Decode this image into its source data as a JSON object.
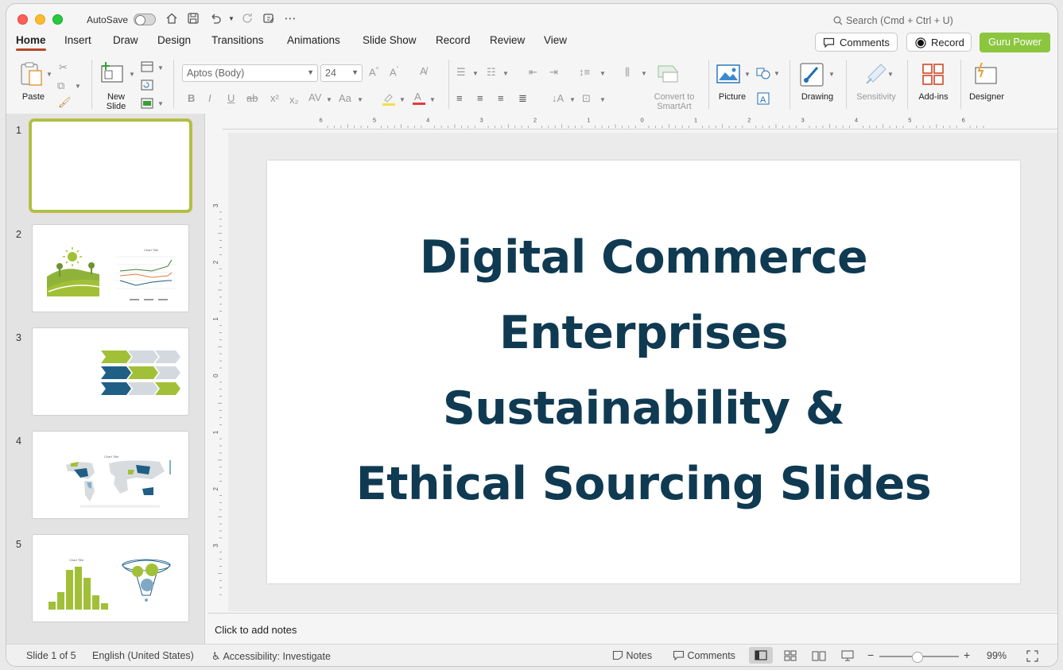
{
  "titlebar": {
    "autosave_label": "AutoSave",
    "search_placeholder": "Search (Cmd + Ctrl + U)"
  },
  "tabs": [
    {
      "label": "Home"
    },
    {
      "label": "Insert"
    },
    {
      "label": "Draw"
    },
    {
      "label": "Design"
    },
    {
      "label": "Transitions"
    },
    {
      "label": "Animations"
    },
    {
      "label": "Slide Show"
    },
    {
      "label": "Record"
    },
    {
      "label": "Review"
    },
    {
      "label": "View"
    }
  ],
  "header_buttons": {
    "comments": "Comments",
    "record": "Record",
    "guru": "Guru Power"
  },
  "ribbon": {
    "paste": "Paste",
    "new_slide_1": "New",
    "new_slide_2": "Slide",
    "font_name": "Aptos (Body)",
    "font_size": "24",
    "convert_1": "Convert to",
    "convert_2": "SmartArt",
    "picture": "Picture",
    "drawing": "Drawing",
    "sensitivity": "Sensitivity",
    "addins": "Add-ins",
    "designer": "Designer"
  },
  "ruler": {
    "h_labels": [
      "6",
      "5",
      "4",
      "3",
      "2",
      "1",
      "0",
      "1",
      "2",
      "3",
      "4",
      "5",
      "6"
    ],
    "v_labels": [
      "3",
      "2",
      "1",
      "0",
      "1",
      "2",
      "3"
    ]
  },
  "slides": [
    {
      "number": "1"
    },
    {
      "number": "2",
      "chart_title": "Chart Title"
    },
    {
      "number": "3"
    },
    {
      "number": "4",
      "chart_title": "Chart Title"
    },
    {
      "number": "5",
      "chart_title": "Chart Title"
    }
  ],
  "current_slide": {
    "title_lines": [
      "Digital Commerce",
      "Enterprises",
      "Sustainability &",
      "Ethical Sourcing Slides"
    ]
  },
  "notes": {
    "placeholder": "Click to add notes"
  },
  "status": {
    "slide_info": "Slide 1 of 5",
    "language": "English (United States)",
    "accessibility": "Accessibility: Investigate",
    "notes": "Notes",
    "comments": "Comments",
    "zoom": "99%"
  },
  "colors": {
    "title": "#0f3a52",
    "accent_green": "#a2c037",
    "accent_blue": "#1f5f86",
    "home_tab_underline": "#b7472a",
    "guru_button": "#8cc63f"
  }
}
